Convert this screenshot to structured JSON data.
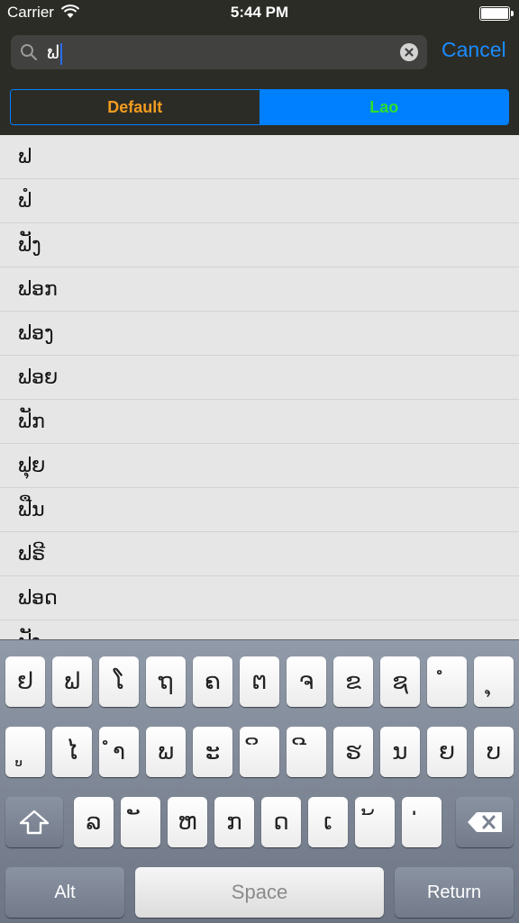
{
  "status_bar": {
    "carrier": "Carrier",
    "time": "5:44 PM"
  },
  "search": {
    "query": "ຟ",
    "cancel_label": "Cancel"
  },
  "segments": {
    "default_label": "Default",
    "lao_label": "Lao",
    "selected": "Lao"
  },
  "results": [
    "ຟ",
    "ຟໍ",
    "ຟັງ",
    "ຟອກ",
    "ຟອງ",
    "ຟອຍ",
    "ຟັກ",
    "ຟຸຍ",
    "ຟືນ",
    "ຟຣີ",
    "ຟອດ",
    "ຟັງ"
  ],
  "keyboard": {
    "row1": [
      "ຢ",
      "ຟ",
      "ໂ",
      "ຖ",
      "ຄ",
      "ຕ",
      "ຈ",
      "ຂ",
      "ຊ",
      "ໍ",
      "ຸ"
    ],
    "row2": [
      "ູ",
      "ໄ",
      "ຳ",
      "ພ",
      "ະ",
      "ິ",
      "ີ",
      "ຮ",
      "ນ",
      "ຍ",
      "ບ"
    ],
    "row3": [
      "ລ",
      "ັ",
      "ຫ",
      "ກ",
      "ດ",
      "ເ",
      "້",
      "່"
    ],
    "alt_label": "Alt",
    "space_label": "Space",
    "return_label": "Return"
  },
  "colors": {
    "accent": "#0080ff",
    "default_segment_text": "#f39c1f",
    "lao_segment_text": "#2ee02e"
  }
}
